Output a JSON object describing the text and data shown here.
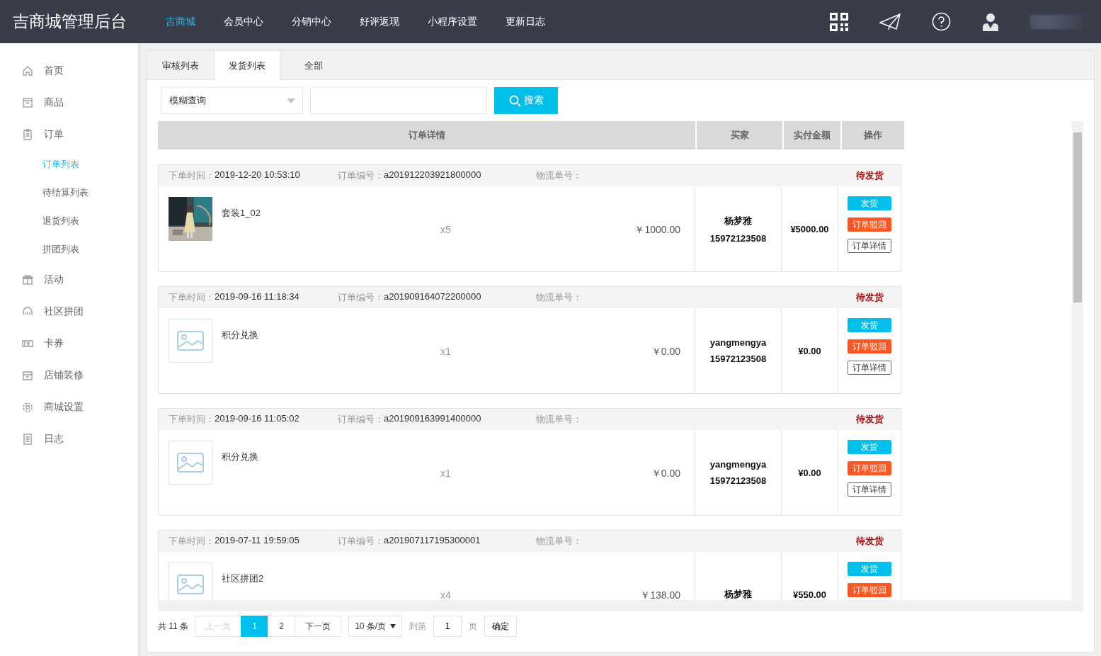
{
  "header": {
    "title": "吉商城管理后台",
    "nav": [
      {
        "label": "吉商城",
        "selected": true
      },
      {
        "label": "会员中心",
        "selected": false
      },
      {
        "label": "分销中心",
        "selected": false
      },
      {
        "label": "好评返现",
        "selected": false
      },
      {
        "label": "小程序设置",
        "selected": false
      },
      {
        "label": "更新日志",
        "selected": false
      }
    ]
  },
  "sidebar": {
    "items": [
      {
        "label": "首页",
        "selected": false
      },
      {
        "label": "商品",
        "selected": false
      },
      {
        "label": "订单",
        "selected": false,
        "children": [
          {
            "label": "订单列表",
            "selected": true
          },
          {
            "label": "待结算列表",
            "selected": false
          },
          {
            "label": "退货列表",
            "selected": false
          },
          {
            "label": "拼团列表",
            "selected": false
          }
        ]
      },
      {
        "label": "活动",
        "selected": false
      },
      {
        "label": "社区拼团",
        "selected": false
      },
      {
        "label": "卡券",
        "selected": false
      },
      {
        "label": "店铺装修",
        "selected": false
      },
      {
        "label": "商城设置",
        "selected": false
      },
      {
        "label": "日志",
        "selected": false
      }
    ]
  },
  "tabs": [
    {
      "label": "审核列表",
      "selected": false
    },
    {
      "label": "发货列表",
      "selected": true
    },
    {
      "label": "全部",
      "selected": false
    }
  ],
  "search": {
    "mode": "模糊查询",
    "button": "搜索"
  },
  "table": {
    "columns": [
      "订单详情",
      "买家",
      "实付金额",
      "操作"
    ],
    "orders": [
      {
        "time_label": "下单时间：",
        "time": "2019-12-20 10:53:10",
        "order_no_label": "订单编号：",
        "order_no": "a201912203921800000",
        "logistics_label": "物流单号：",
        "status": "待发货",
        "product": {
          "kind": "picture",
          "name": "套装1_02",
          "quantity": "x5",
          "price": "￥1000.00"
        },
        "buyer": {
          "name": "杨梦雅",
          "phone": "15972123508"
        },
        "paid": "¥5000.00",
        "actions": [
          {
            "label": "发货",
            "kind": "ship"
          },
          {
            "label": "订单驳回",
            "kind": "reject"
          },
          {
            "label": "订单详情",
            "kind": "detail"
          }
        ]
      },
      {
        "time_label": "下单时间：",
        "time": "2019-09-16 11:18:34",
        "order_no_label": "订单编号：",
        "order_no": "a201909164072200000",
        "logistics_label": "物流单号：",
        "status": "待发货",
        "product": {
          "kind": "placeholder",
          "name": "积分兑换",
          "quantity": "x1",
          "price": "￥0.00"
        },
        "buyer": {
          "name": "yangmengya",
          "phone": "15972123508"
        },
        "paid": "¥0.00",
        "actions": [
          {
            "label": "发货",
            "kind": "ship"
          },
          {
            "label": "订单驳回",
            "kind": "reject"
          },
          {
            "label": "订单详情",
            "kind": "detail"
          }
        ]
      },
      {
        "time_label": "下单时间：",
        "time": "2019-09-16 11:05:02",
        "order_no_label": "订单编号：",
        "order_no": "a201909163991400000",
        "logistics_label": "物流单号：",
        "status": "待发货",
        "product": {
          "kind": "placeholder",
          "name": "积分兑换",
          "quantity": "x1",
          "price": "￥0.00"
        },
        "buyer": {
          "name": "yangmengya",
          "phone": "15972123508"
        },
        "paid": "¥0.00",
        "actions": [
          {
            "label": "发货",
            "kind": "ship"
          },
          {
            "label": "订单驳回",
            "kind": "reject"
          },
          {
            "label": "订单详情",
            "kind": "detail"
          }
        ]
      },
      {
        "time_label": "下单时间：",
        "time": "2019-07-11 19:59:05",
        "order_no_label": "订单编号：",
        "order_no": "a201907117195300001",
        "logistics_label": "物流单号：",
        "status": "待发货",
        "product": {
          "kind": "placeholder",
          "name": "社区拼团2",
          "quantity": "x4",
          "price": "￥138.00"
        },
        "buyer": {
          "name": "杨梦雅"
        },
        "paid": "¥550.00",
        "actions": [
          {
            "label": "发货",
            "kind": "ship"
          },
          {
            "label": "订单驳回",
            "kind": "reject"
          }
        ]
      }
    ]
  },
  "pagination": {
    "total": "共 11 条",
    "prev": {
      "label": "上一页",
      "disabled": true
    },
    "pages": [
      {
        "label": "1",
        "selected": true
      },
      {
        "label": "2",
        "selected": false
      }
    ],
    "next": {
      "label": "下一页",
      "disabled": false
    },
    "page_size": "10 条/页",
    "goto_label": "到第",
    "goto_value": "1",
    "page_unit": "页",
    "confirm": "确定"
  }
}
